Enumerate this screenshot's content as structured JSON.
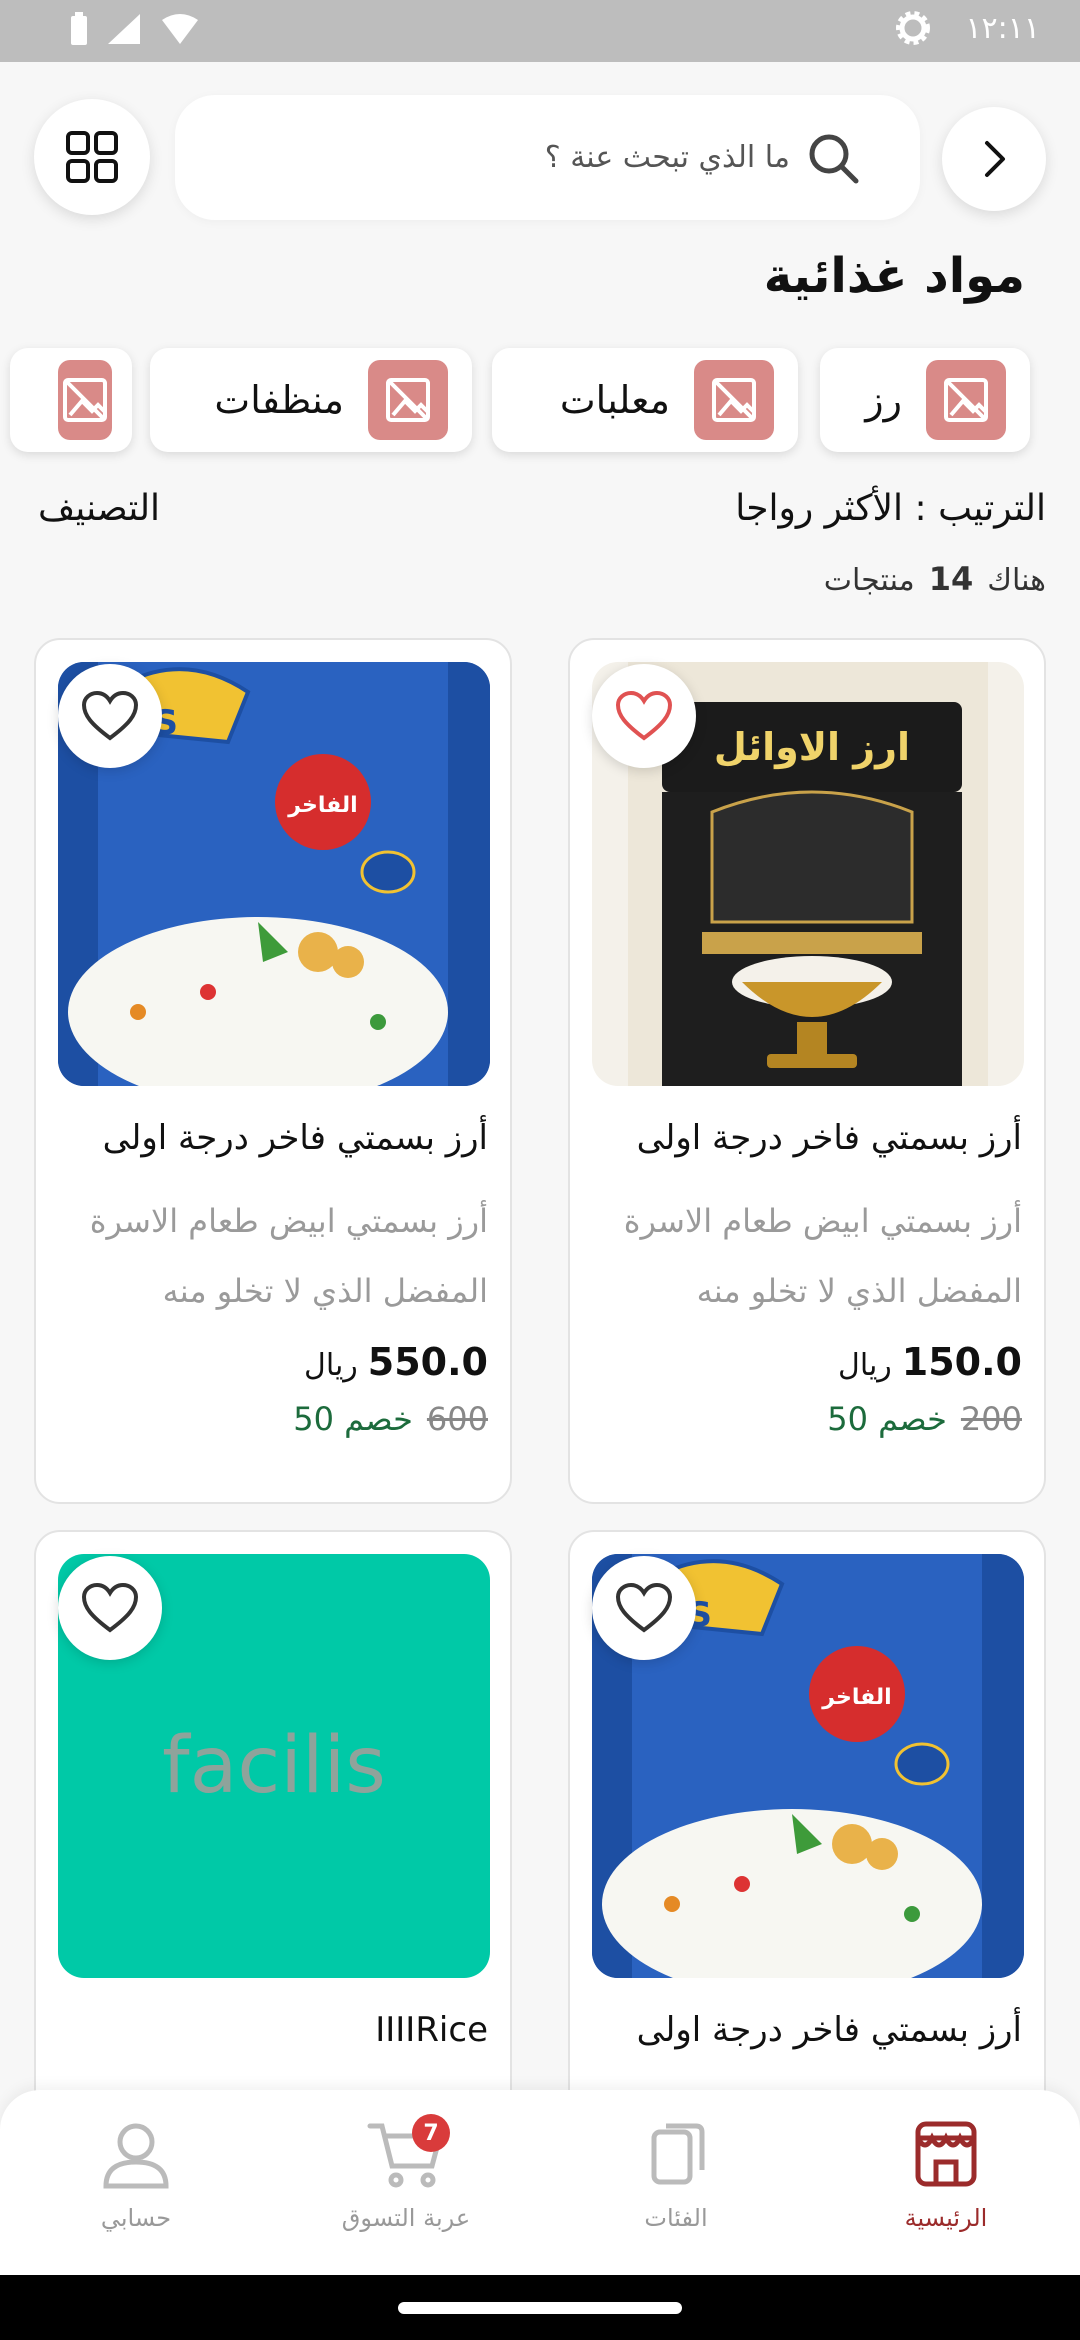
{
  "status_bar": {
    "time": "١٢:١١"
  },
  "header": {
    "search_placeholder": "ما الذي تبحث عنة ؟"
  },
  "page_title": "مواد غذائية",
  "categories": [
    {
      "label": "رز"
    },
    {
      "label": "معلبات"
    },
    {
      "label": "منظفات"
    },
    {
      "label": ""
    }
  ],
  "sort": {
    "label": "الترتيب : الأكثر رواجا"
  },
  "classify": {
    "label": "التصنيف"
  },
  "results": {
    "prefix": "هناك",
    "count": "14",
    "suffix": "منتجات"
  },
  "products": [
    {
      "name": "أرز بسمتي فاخر درجة اولى",
      "description": "أرز بسمتي ابيض طعام الاسرة المفضل الذي لا تخلو منه",
      "price": "150.0",
      "currency": "ريال",
      "old_price": "200",
      "discount": "خصم 50",
      "image": "rice-bag-awael"
    },
    {
      "name": "أرز بسمتي فاخر درجة اولى",
      "description": "أرز بسمتي ابيض طعام الاسرة المفضل الذي لا تخلو منه",
      "price": "550.0",
      "currency": "ريال",
      "old_price": "600",
      "discount": "خصم 50",
      "image": "rice-bag-blue"
    },
    {
      "name": "أرز بسمتي فاخر درجة اولى",
      "image": "rice-bag-blue"
    },
    {
      "name": "IIIIRice",
      "image_text": "facilis",
      "image_color": "#00c9a7"
    }
  ],
  "bottom_nav": [
    {
      "label": "الرئيسية",
      "active": true
    },
    {
      "label": "الفئات"
    },
    {
      "label": "عربة التسوق",
      "badge": "7"
    },
    {
      "label": "حسابي"
    }
  ],
  "colors": {
    "accent": "#9b2b2b",
    "discount": "#1c6b3c",
    "chip_thumb": "#d98a88"
  }
}
